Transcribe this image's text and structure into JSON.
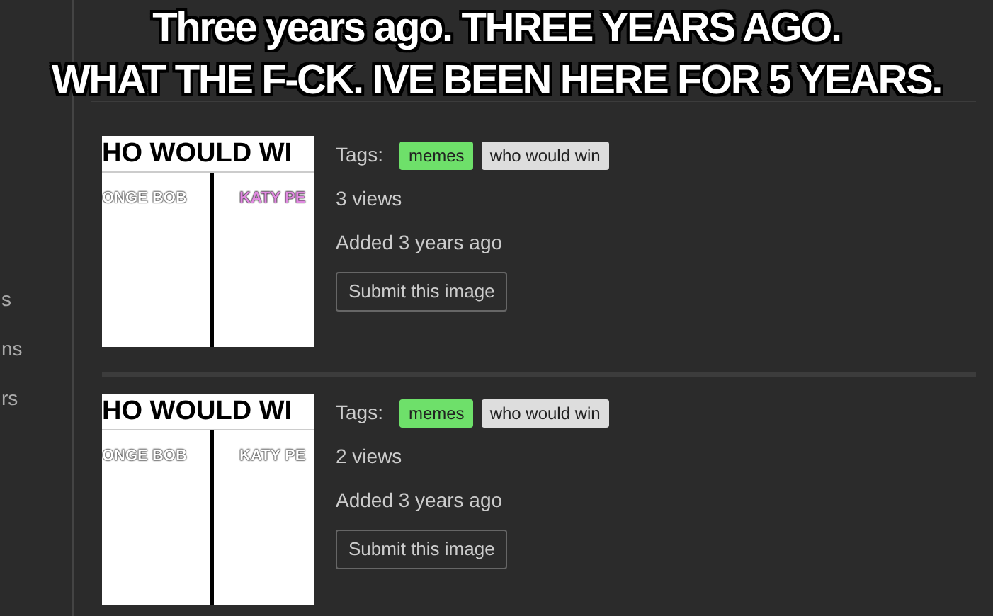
{
  "caption": [
    "Three years ago. THREE YEARS AGO.",
    "WHAT THE F-CK. IVE BEEN HERE FOR 5 YEARS."
  ],
  "sidebar": {
    "items": [
      "s",
      "ns",
      "rs"
    ]
  },
  "images": [
    {
      "thumbnail": {
        "title": "HO WOULD WI",
        "labels": [
          {
            "text": "ONGE BOB",
            "color": "#ffffff"
          },
          {
            "text": "KATY PE",
            "color": "#e08ae0"
          }
        ]
      },
      "tags_label": "Tags:",
      "tags": [
        {
          "label": "memes",
          "color": "#6ee06a"
        },
        {
          "label": "who would win",
          "color": "#dddddd"
        }
      ],
      "views": "3 views",
      "added": "Added 3 years ago",
      "button": "Submit this image"
    },
    {
      "thumbnail": {
        "title": "HO WOULD WI",
        "labels": [
          {
            "text": "ONGE BOB",
            "color": "#ffffff"
          },
          {
            "text": "KATY PE",
            "color": "#ffffff"
          }
        ]
      },
      "tags_label": "Tags:",
      "tags": [
        {
          "label": "memes",
          "color": "#6ee06a"
        },
        {
          "label": "who would win",
          "color": "#dddddd"
        }
      ],
      "views": "2 views",
      "added": "Added 3 years ago",
      "button": "Submit this image"
    }
  ]
}
